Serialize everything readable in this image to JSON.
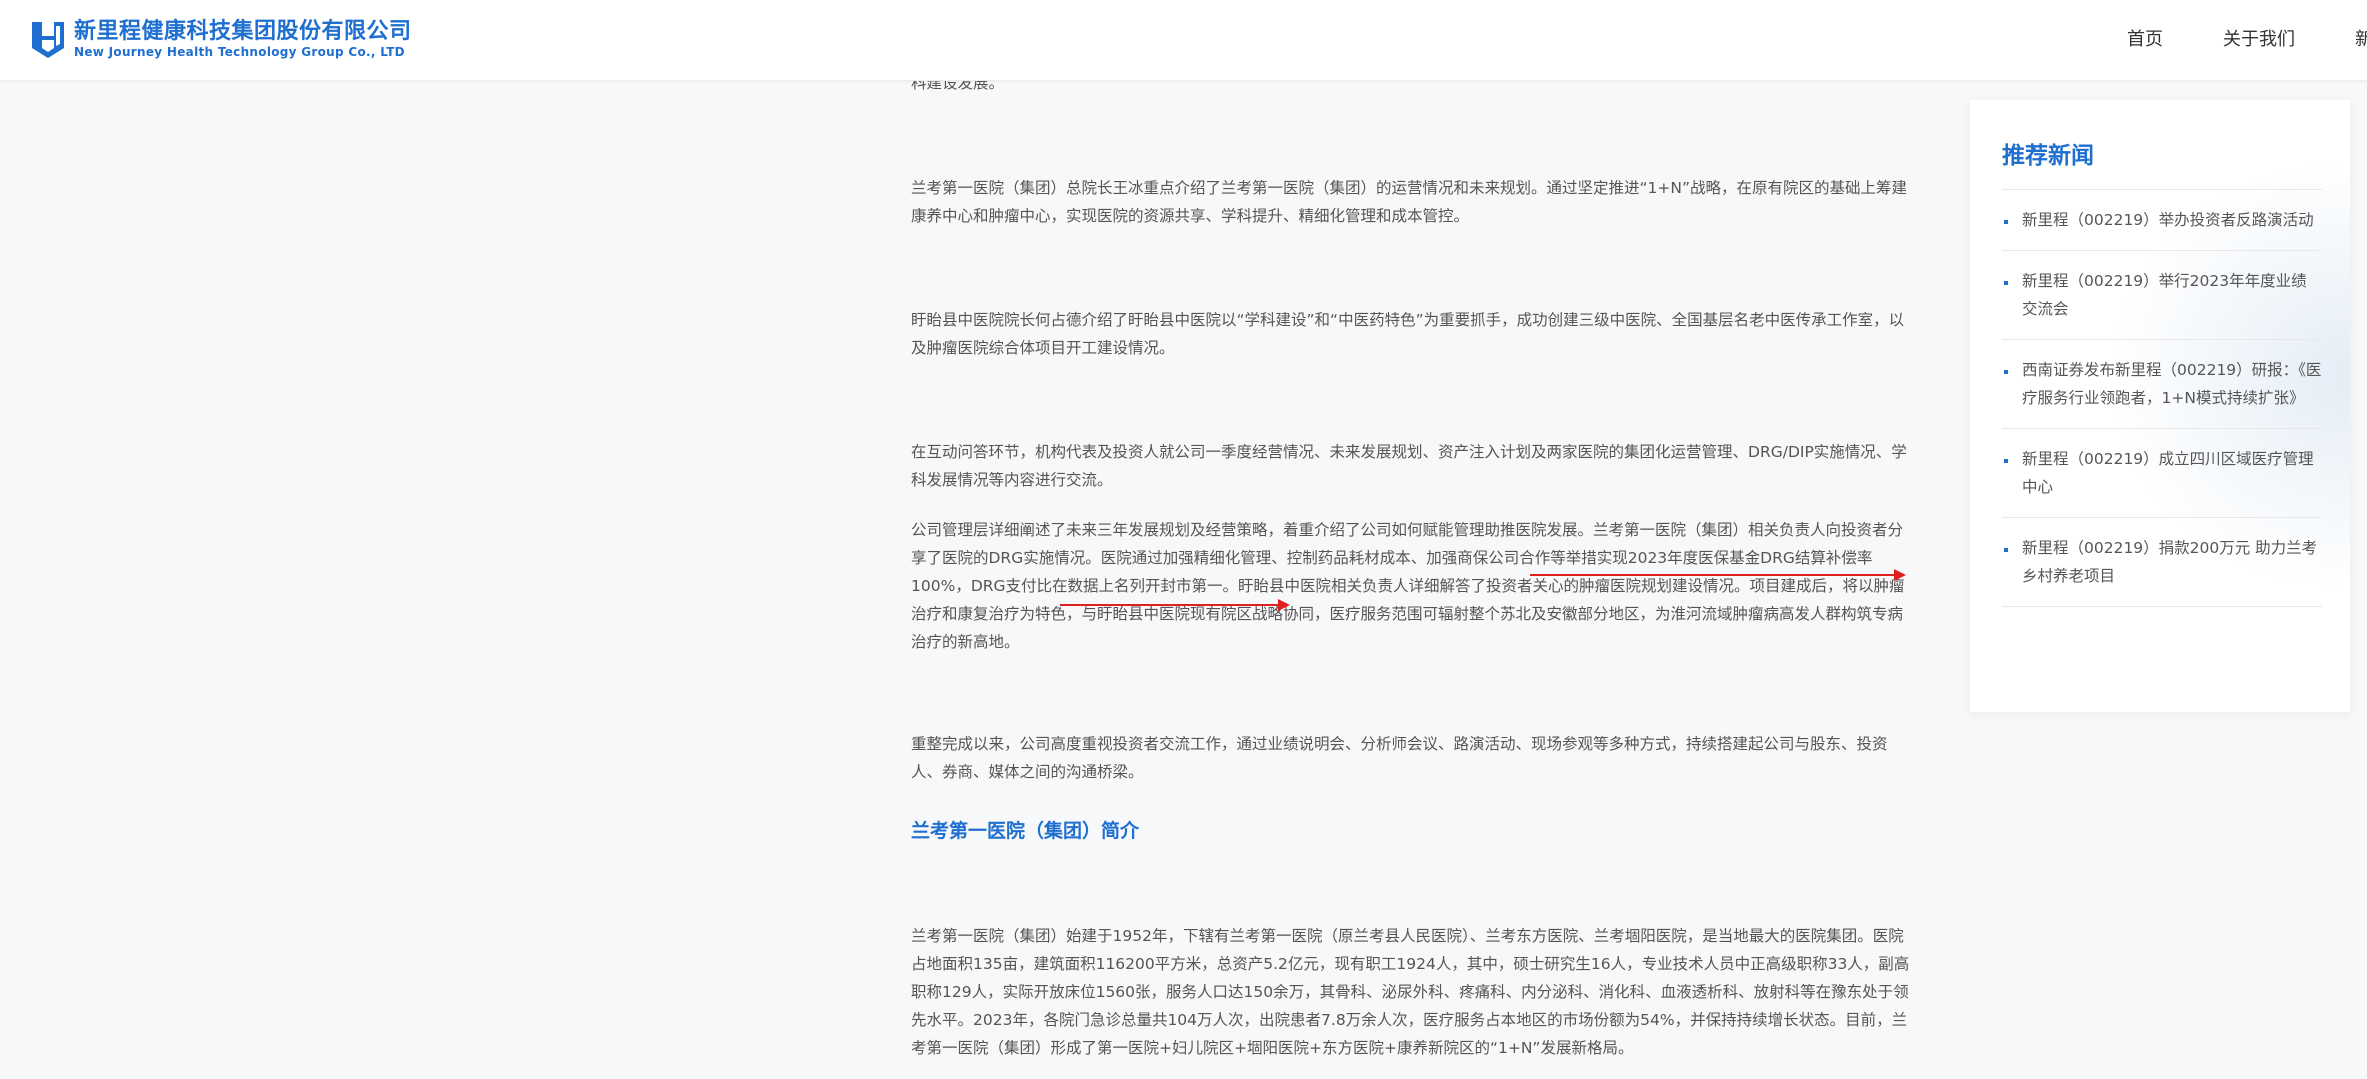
{
  "header": {
    "company_cn": "新里程健康科技集团股份有限公司",
    "company_en": "New Journey Health Technology Group Co., LTD",
    "nav": [
      "首页",
      "关于我们",
      "新"
    ]
  },
  "article": {
    "top_fragment": "科建设发展。",
    "p1": "兰考第一医院（集团）总院长王冰重点介绍了兰考第一医院（集团）的运营情况和未来规划。通过坚定推进“1+N”战略，在原有院区的基础上筹建康养中心和肿瘤中心，实现医院的资源共享、学科提升、精细化管理和成本管控。",
    "p2": "盱眙县中医院院长何占德介绍了盱眙县中医院以“学科建设”和“中医药特色”为重要抓手，成功创建三级中医院、全国基层名老中医传承工作室，以及肿瘤医院综合体项目开工建设情况。",
    "p3": "在互动问答环节，机构代表及投资人就公司一季度经营情况、未来发展规划、资产注入计划及两家医院的集团化运营管理、DRG/DIP实施情况、学科发展情况等内容进行交流。",
    "p4": "公司管理层详细阐述了未来三年发展规划及经营策略，着重介绍了公司如何赋能管理助推医院发展。兰考第一医院（集团）相关负责人向投资者分享了医院的DRG实施情况。医院通过加强精细化管理、控制药品耗材成本、加强商保公司合作等举措实现2023年度医保基金DRG结算补偿率100%，DRG支付比在数据上名列开封市第一。盱眙县中医院相关负责人详细解答了投资者关心的肿瘤医院规划建设情况。项目建成后，将以肿瘤治疗和康复治疗为特色，与盱眙县中医院现有院区战略协同，医疗服务范围可辐射整个苏北及安徽部分地区，为淮河流域肿瘤病高发人群构筑专病治疗的新高地。",
    "p5": "重整完成以来，公司高度重视投资者交流工作，通过业绩说明会、分析师会议、路演活动、现场参观等多种方式，持续搭建起公司与股东、投资人、券商、媒体之间的沟通桥梁。",
    "subtitle": "兰考第一医院（集团）简介",
    "p6": "兰考第一医院（集团）始建于1952年，下辖有兰考第一医院（原兰考县人民医院）、兰考东方医院、兰考堌阳医院，是当地最大的医院集团。医院占地面积135亩，建筑面积116200平方米，总资产5.2亿元，现有职工1924人，其中，硕士研究生16人，专业技术人员中正高级职称33人，副高职称129人，实际开放床位1560张，服务人口达150余万，其骨科、泌尿外科、疼痛科、内分泌科、消化科、血液透析科、放射科等在豫东处于领先水平。2023年，各院门急诊总量共104万人次，出院患者7.8万余人次，医疗服务占本地区的市场份额为54%，并保持持续增长状态。目前，兰考第一医院（集团）形成了第一医院+妇儿院区+堌阳医院+东方医院+康养新院区的“1+N”发展新格局。"
  },
  "sidebar": {
    "title": "推荐新闻",
    "items": [
      "新里程（002219）举办投资者反路演活动",
      "新里程（002219）举行2023年年度业绩交流会",
      "西南证券发布新里程（002219）研报：《医疗服务行业领跑者，1+N模式持续扩张》",
      "新里程（002219）成立四川区域医疗管理中心",
      "新里程（002219）捐款200万元 助力兰考乡村养老项目"
    ]
  },
  "colors": {
    "brand": "#1e6fd0",
    "annotation_arrow": "#e02020"
  }
}
